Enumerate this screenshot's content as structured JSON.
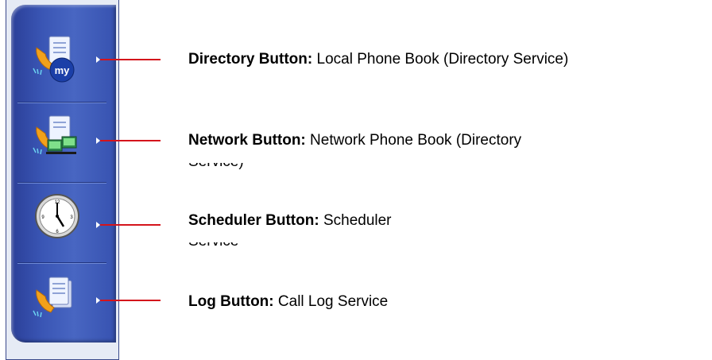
{
  "buttons": [
    {
      "name": "Directory Button:",
      "desc": "Local Phone Book (Directory Service)",
      "icon": "phone-book-my-icon",
      "wrap": ""
    },
    {
      "name": "Network Button:",
      "desc": "Network Phone Book (Directory",
      "icon": "phone-book-network-icon",
      "wrap": "Service)"
    },
    {
      "name": "Scheduler Button:",
      "desc": "Scheduler",
      "icon": "clock-icon",
      "wrap": "Service"
    },
    {
      "name": "Log Button:",
      "desc": "Call Log Service",
      "icon": "call-log-icon",
      "wrap": ""
    }
  ],
  "icon_badge_text": "my",
  "colors": {
    "panel": "#3a56b5",
    "callout_line": "#d4141c",
    "phone": "#f2a11b"
  }
}
